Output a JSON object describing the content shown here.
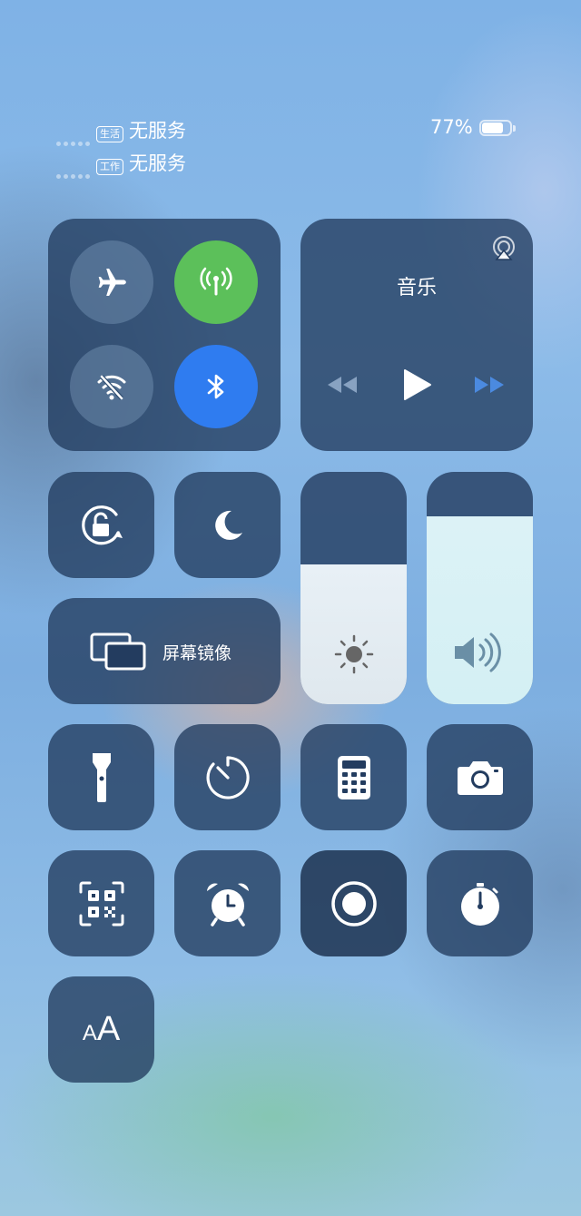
{
  "status_bar": {
    "sim1": {
      "badge": "生活",
      "status": "无服务"
    },
    "sim2": {
      "badge": "工作",
      "status": "无服务"
    },
    "battery_percent_label": "77%",
    "battery_level": 0.77
  },
  "connectivity": {
    "airplane_mode": false,
    "cellular_data": true,
    "wifi": false,
    "bluetooth": true
  },
  "music": {
    "title": "音乐"
  },
  "screen_mirroring": {
    "label": "屏幕镜像"
  },
  "sliders": {
    "brightness_level": 0.6,
    "volume_level": 0.81
  },
  "colors": {
    "cellular_active": "#5cc05a",
    "bluetooth_active": "#2f7cf0",
    "tile_bg": "#233c5f"
  },
  "icons": [
    "airplane-icon",
    "antenna-icon",
    "wifi-off-icon",
    "bluetooth-icon",
    "airplay-icon",
    "rewind-icon",
    "play-icon",
    "fast-forward-icon",
    "rotation-lock-icon",
    "moon-icon",
    "screen-mirroring-icon",
    "sun-icon",
    "speaker-icon",
    "flashlight-icon",
    "timer-icon",
    "calculator-icon",
    "camera-icon",
    "qr-scanner-icon",
    "alarm-icon",
    "screen-record-icon",
    "stopwatch-icon",
    "text-size-icon"
  ]
}
